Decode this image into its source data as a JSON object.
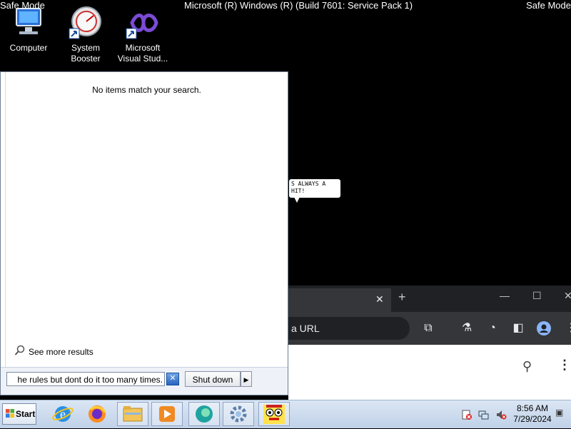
{
  "overlay": {
    "left_label": "Safe Mode",
    "right_label": "Safe Mode",
    "title": "Microsoft (R) Windows (R) (Build 7601: Service Pack 1)"
  },
  "desktop_icons": [
    {
      "label": "Computer",
      "icon": "computer-icon"
    },
    {
      "label": "System\nBooster",
      "icon": "speedometer-icon"
    },
    {
      "label": "Microsoft\nVisual Stud...",
      "icon": "visual-studio-icon"
    }
  ],
  "start_menu": {
    "empty_message": "No items match your search.",
    "see_more": "See more results",
    "search_value": "he rules but dont do it too many times.",
    "shutdown_label": "Shut down"
  },
  "bubble_text": "S ALWAYS A\nHIT!",
  "browser": {
    "omnibox_text": "a URL"
  },
  "taskbar": {
    "start_label": "Start",
    "apps": [
      "internet-explorer-icon",
      "firefox-icon",
      "explorer-folder-icon",
      "media-player-icon",
      "edge-icon",
      "settings-gear-icon",
      "cartoon-app-icon"
    ],
    "clock_time": "8:56 AM",
    "clock_date": "7/29/2024"
  },
  "colors": {
    "desktop_bg": "#000000",
    "taskbar_bg": "#c0d1e8",
    "browser_bg": "#202124"
  }
}
